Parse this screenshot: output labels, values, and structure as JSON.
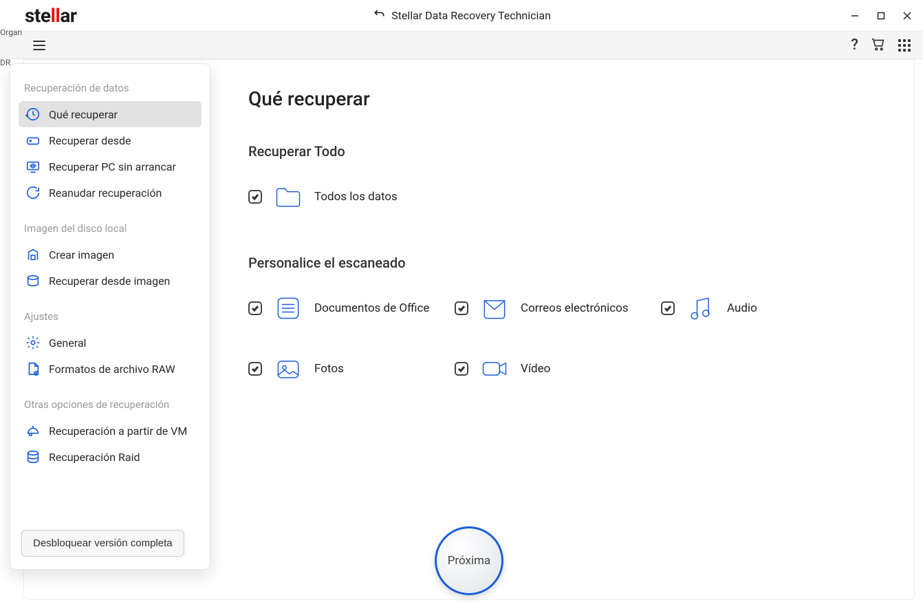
{
  "titlebar": {
    "logo_pre": "ste",
    "logo_mid": "ll",
    "logo_post": "ar",
    "app_title": "Stellar Data Recovery Technician"
  },
  "sidebar": {
    "sections": {
      "data": {
        "title": "Recuperación de datos",
        "items": [
          {
            "label": "Qué recuperar",
            "icon": "restore",
            "active": true
          },
          {
            "label": "Recuperar desde",
            "icon": "drive"
          },
          {
            "label": "Recuperar PC sin arrancar",
            "icon": "pc-noboot"
          },
          {
            "label": "Reanudar recuperación",
            "icon": "resume"
          }
        ]
      },
      "image": {
        "title": "Imagen del disco local",
        "items": [
          {
            "label": "Crear imagen",
            "icon": "create-image"
          },
          {
            "label": "Recuperar desde imagen",
            "icon": "recover-image"
          }
        ]
      },
      "settings": {
        "title": "Ajustes",
        "items": [
          {
            "label": "General",
            "icon": "gear"
          },
          {
            "label": "Formatos de archivo RAW",
            "icon": "raw"
          }
        ]
      },
      "other": {
        "title": "Otras opciones de recuperación",
        "items": [
          {
            "label": "Recuperación a partir de VM",
            "icon": "vm"
          },
          {
            "label": "Recuperación Raid",
            "icon": "raid"
          }
        ]
      }
    },
    "unlock_label": "Desbloquear versión completa"
  },
  "main": {
    "page_title": "Qué recuperar",
    "section_all": "Recuperar Todo",
    "section_custom": "Personalice el escaneado",
    "options": {
      "all": {
        "label": "Todos los datos",
        "checked": true
      },
      "office": {
        "label": "Documentos de Office",
        "checked": true
      },
      "emails": {
        "label": "Correos electrónicos",
        "checked": true
      },
      "audio": {
        "label": "Audio",
        "checked": true
      },
      "photos": {
        "label": "Fotos",
        "checked": true
      },
      "video": {
        "label": "Vídeo",
        "checked": true
      }
    },
    "next_label": "Próxima"
  },
  "bg_edge": {
    "l1": "Organ",
    "l2": "DR"
  }
}
